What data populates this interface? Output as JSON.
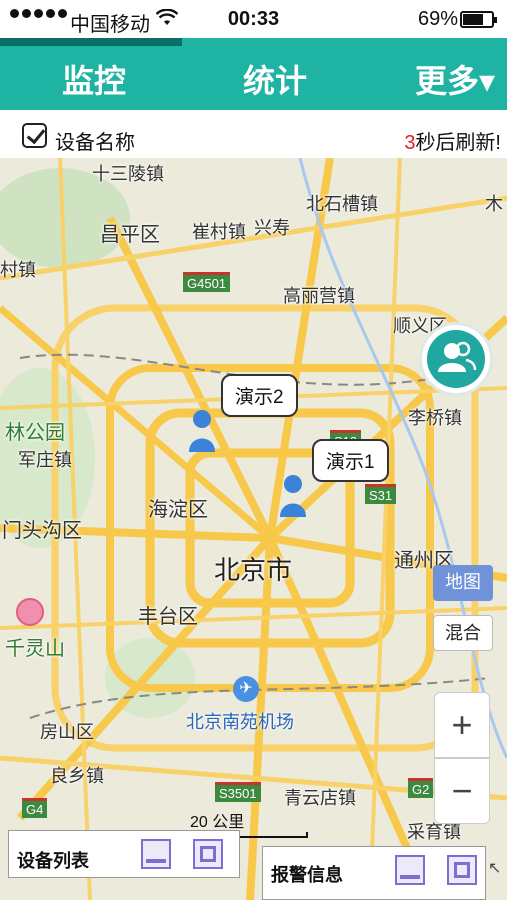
{
  "status_bar": {
    "carrier": "中国移动",
    "time": "00:33",
    "battery": "69%",
    "battery_level": 0.69
  },
  "nav": {
    "monitor": "监控",
    "stats": "统计",
    "more": "更多▾"
  },
  "subheader": {
    "device_name_label": "设备名称",
    "device_name_checked": true,
    "refresh_count": "3",
    "refresh_suffix": "秒后刷新!"
  },
  "map": {
    "labels": {
      "shisanling": "十三陵镇",
      "beishicao": "北石槽镇",
      "changping": "昌平区",
      "cuicun": "崔村镇",
      "xingshou": "兴寿",
      "mu": "木",
      "cun": "村镇",
      "g4501": "G4501",
      "gaoliying": "高丽营镇",
      "shunyi": "顺义区",
      "linpark": "林公园",
      "junzhuang": "军庄镇",
      "liqiao": "李桥镇",
      "s12": "S12",
      "s31": "S31",
      "haidian": "海淀区",
      "mentougou": "门头沟区",
      "beijing": "北京市",
      "tongzhou": "通州区",
      "fengtai": "丰台区",
      "qianlingshan": "千灵山",
      "nanyuan": "北京南苑机场",
      "fangshan": "房山区",
      "liangxiang": "良乡镇",
      "s3501": "S3501",
      "qingyundian": "青云店镇",
      "g4": "G4",
      "g2": "G2",
      "caiyu": "采育镇"
    },
    "markers": [
      "演示2",
      "演示1"
    ],
    "map_type_active": "地图",
    "map_type_idle": "混合",
    "zoom_in": "+",
    "zoom_out": "−",
    "scale": "20 公里"
  },
  "panels": {
    "devices_title": "设备列表",
    "alarms_title": "报警信息"
  },
  "icons": {
    "wifi": "wifi-icon",
    "people": "people-icon",
    "airport": "airport-icon",
    "marker": "person-marker-icon"
  },
  "colors": {
    "accent": "#1fb3a4",
    "accent_dark": "#0c6f67",
    "refresh_count": "#e52020",
    "road": "#f7c84a",
    "map_button": "#6f92d8"
  }
}
